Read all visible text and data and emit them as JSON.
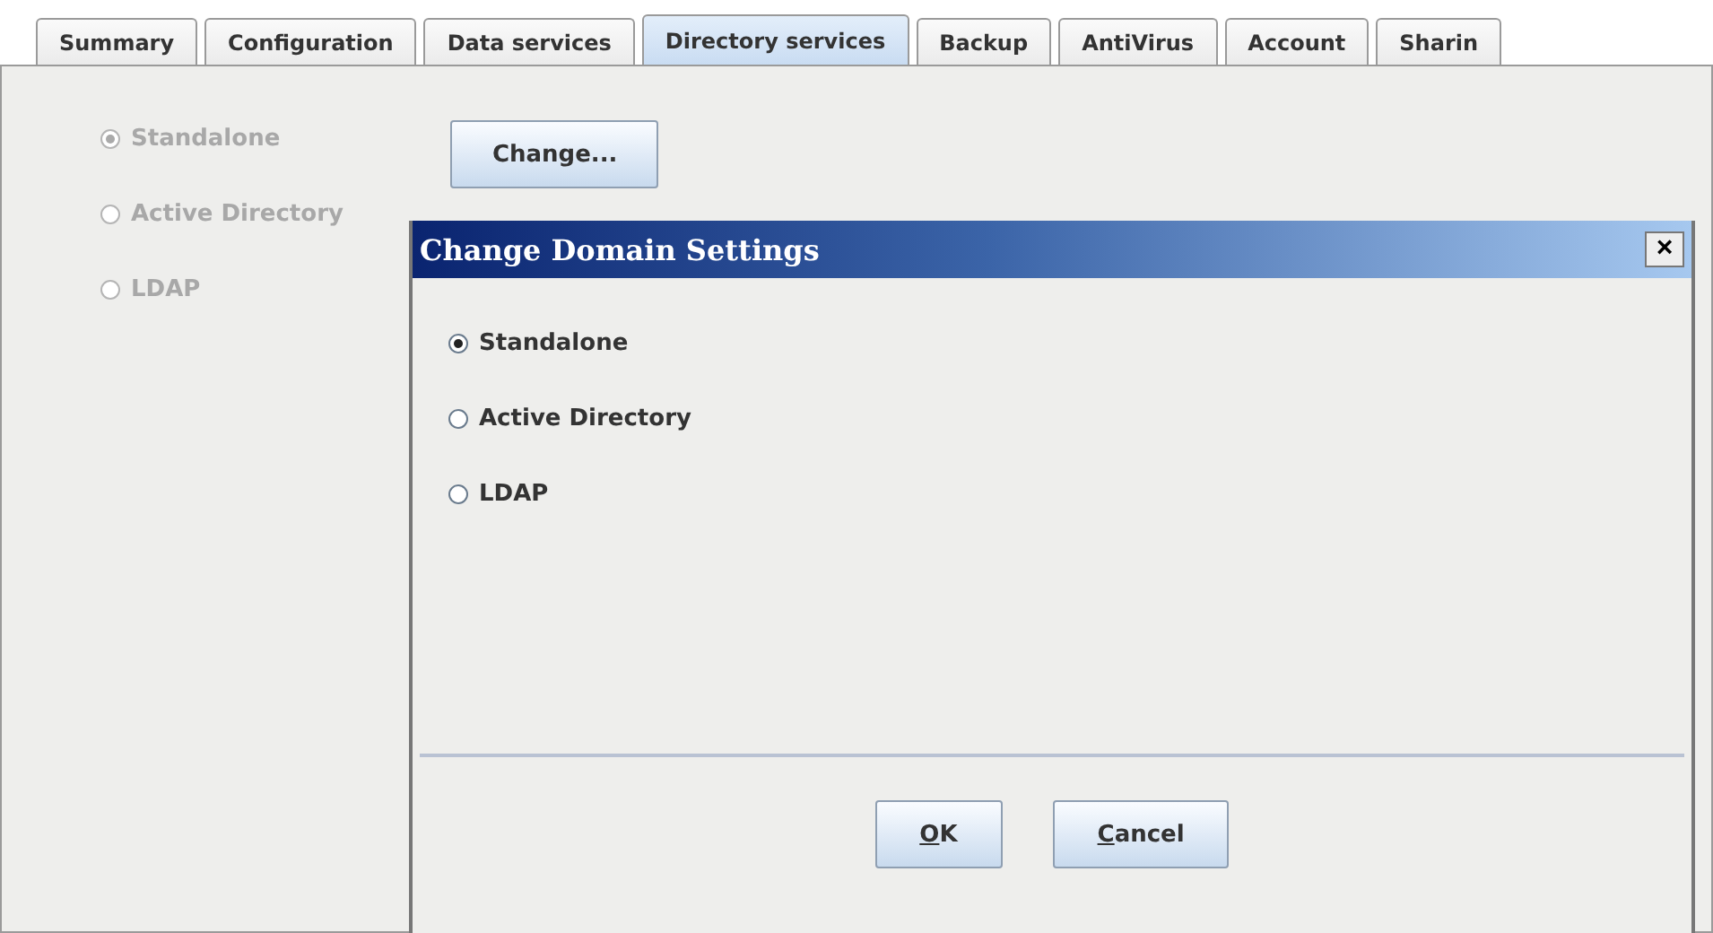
{
  "tabs": [
    {
      "label": "Summary",
      "selected": false
    },
    {
      "label": "Configuration",
      "selected": false
    },
    {
      "label": "Data services",
      "selected": false
    },
    {
      "label": "Directory services",
      "selected": true
    },
    {
      "label": "Backup",
      "selected": false
    },
    {
      "label": "AntiVirus",
      "selected": false
    },
    {
      "label": "Account",
      "selected": false
    },
    {
      "label": "Sharin",
      "selected": false
    }
  ],
  "domain_options": {
    "disabled": true,
    "items": [
      {
        "label": "Standalone",
        "selected": true
      },
      {
        "label": "Active Directory",
        "selected": false
      },
      {
        "label": "LDAP",
        "selected": false
      }
    ]
  },
  "change_button": {
    "label": "Change..."
  },
  "dialog": {
    "title": "Change Domain Settings",
    "close": "×",
    "options": [
      {
        "label": "Standalone",
        "selected": true
      },
      {
        "label": "Active Directory",
        "selected": false
      },
      {
        "label": "LDAP",
        "selected": false
      }
    ],
    "buttons": [
      {
        "label": "OK",
        "mnemonic_underlined": true
      },
      {
        "label": "Cancel",
        "mnemonic_underlined": true
      }
    ]
  }
}
